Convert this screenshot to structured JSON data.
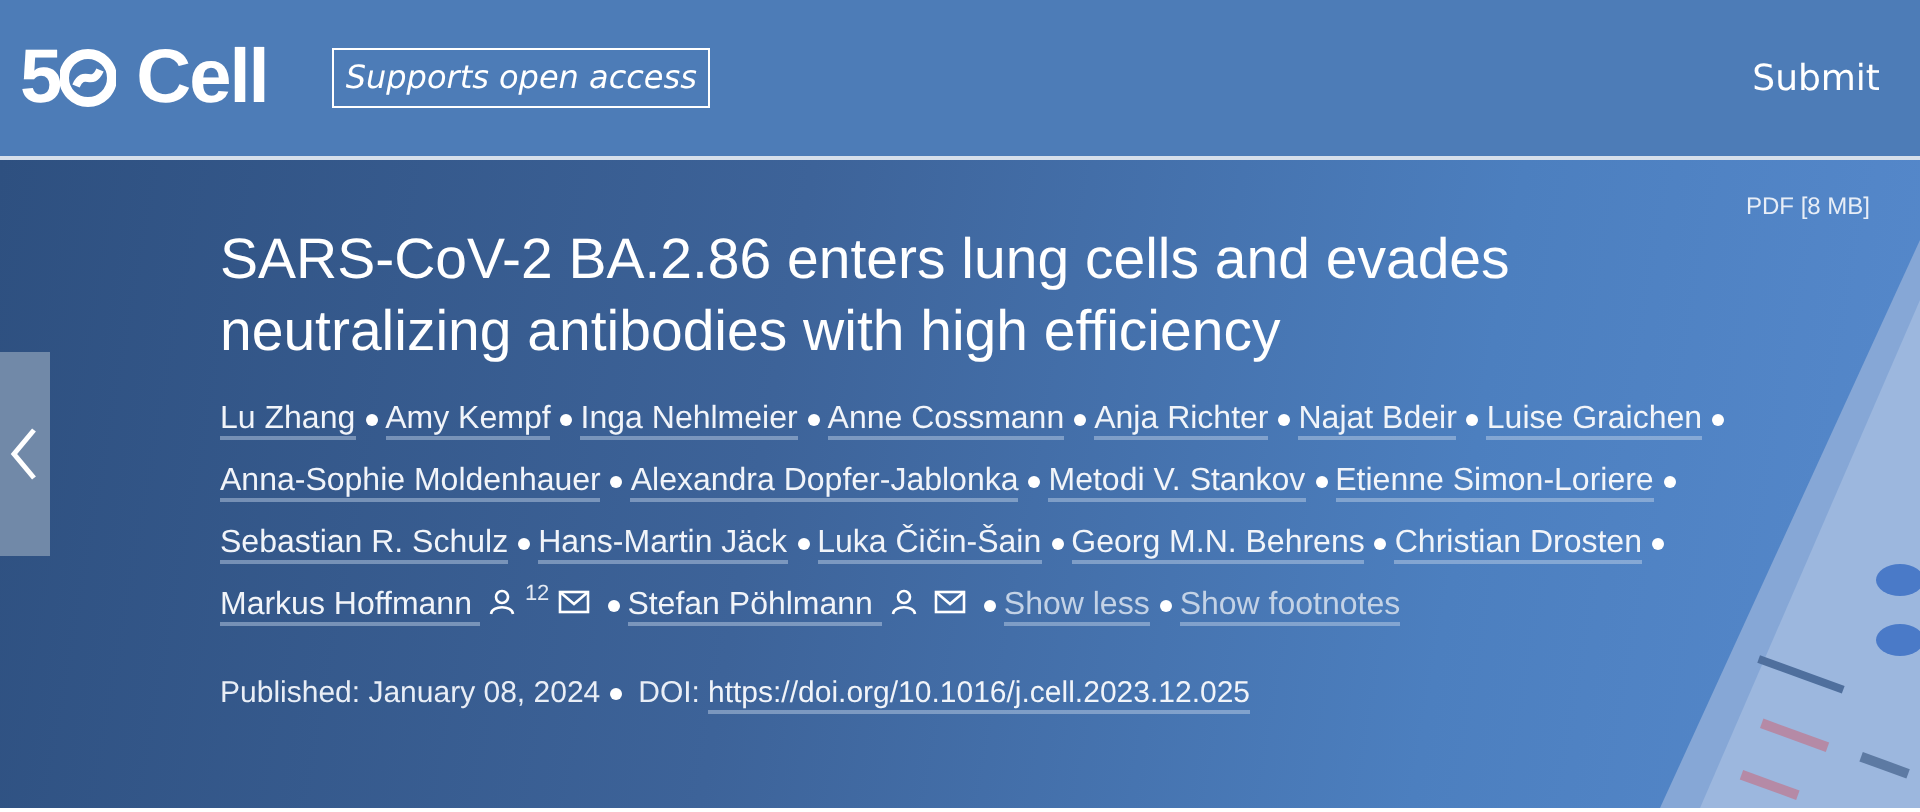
{
  "header": {
    "logo": {
      "number": "5",
      "name": "Cell"
    },
    "open_access_badge": "Supports open access",
    "submit": "Submit"
  },
  "hero": {
    "pdf_link": "PDF [8 MB]",
    "title": "SARS-CoV-2 BA.2.86 enters lung cells and evades neutralizing antibodies with high efficiency",
    "authors": [
      {
        "name": "Lu Zhang"
      },
      {
        "name": "Amy Kempf"
      },
      {
        "name": "Inga Nehlmeier"
      },
      {
        "name": "Anne Cossmann"
      },
      {
        "name": "Anja Richter"
      },
      {
        "name": "Najat Bdeir"
      },
      {
        "name": "Luise Graichen"
      },
      {
        "name": "Anna-Sophie Moldenhauer"
      },
      {
        "name": "Alexandra Dopfer-Jablonka"
      },
      {
        "name": "Metodi V. Stankov"
      },
      {
        "name": "Etienne Simon-Loriere"
      },
      {
        "name": "Sebastian R. Schulz"
      },
      {
        "name": "Hans-Martin Jäck"
      },
      {
        "name": "Luka Čičin-Šain"
      },
      {
        "name": "Georg M.N. Behrens"
      },
      {
        "name": "Christian Drosten"
      },
      {
        "name": "Markus Hoffmann",
        "corresponding": true,
        "note": "12"
      },
      {
        "name": "Stefan Pöhlmann",
        "corresponding": true
      }
    ],
    "links": [
      "Show less",
      "Show footnotes"
    ],
    "published": "Published: January 08, 2024",
    "doi_label": "DOI:",
    "doi": "https://doi.org/10.1016/j.cell.2023.12.025"
  }
}
